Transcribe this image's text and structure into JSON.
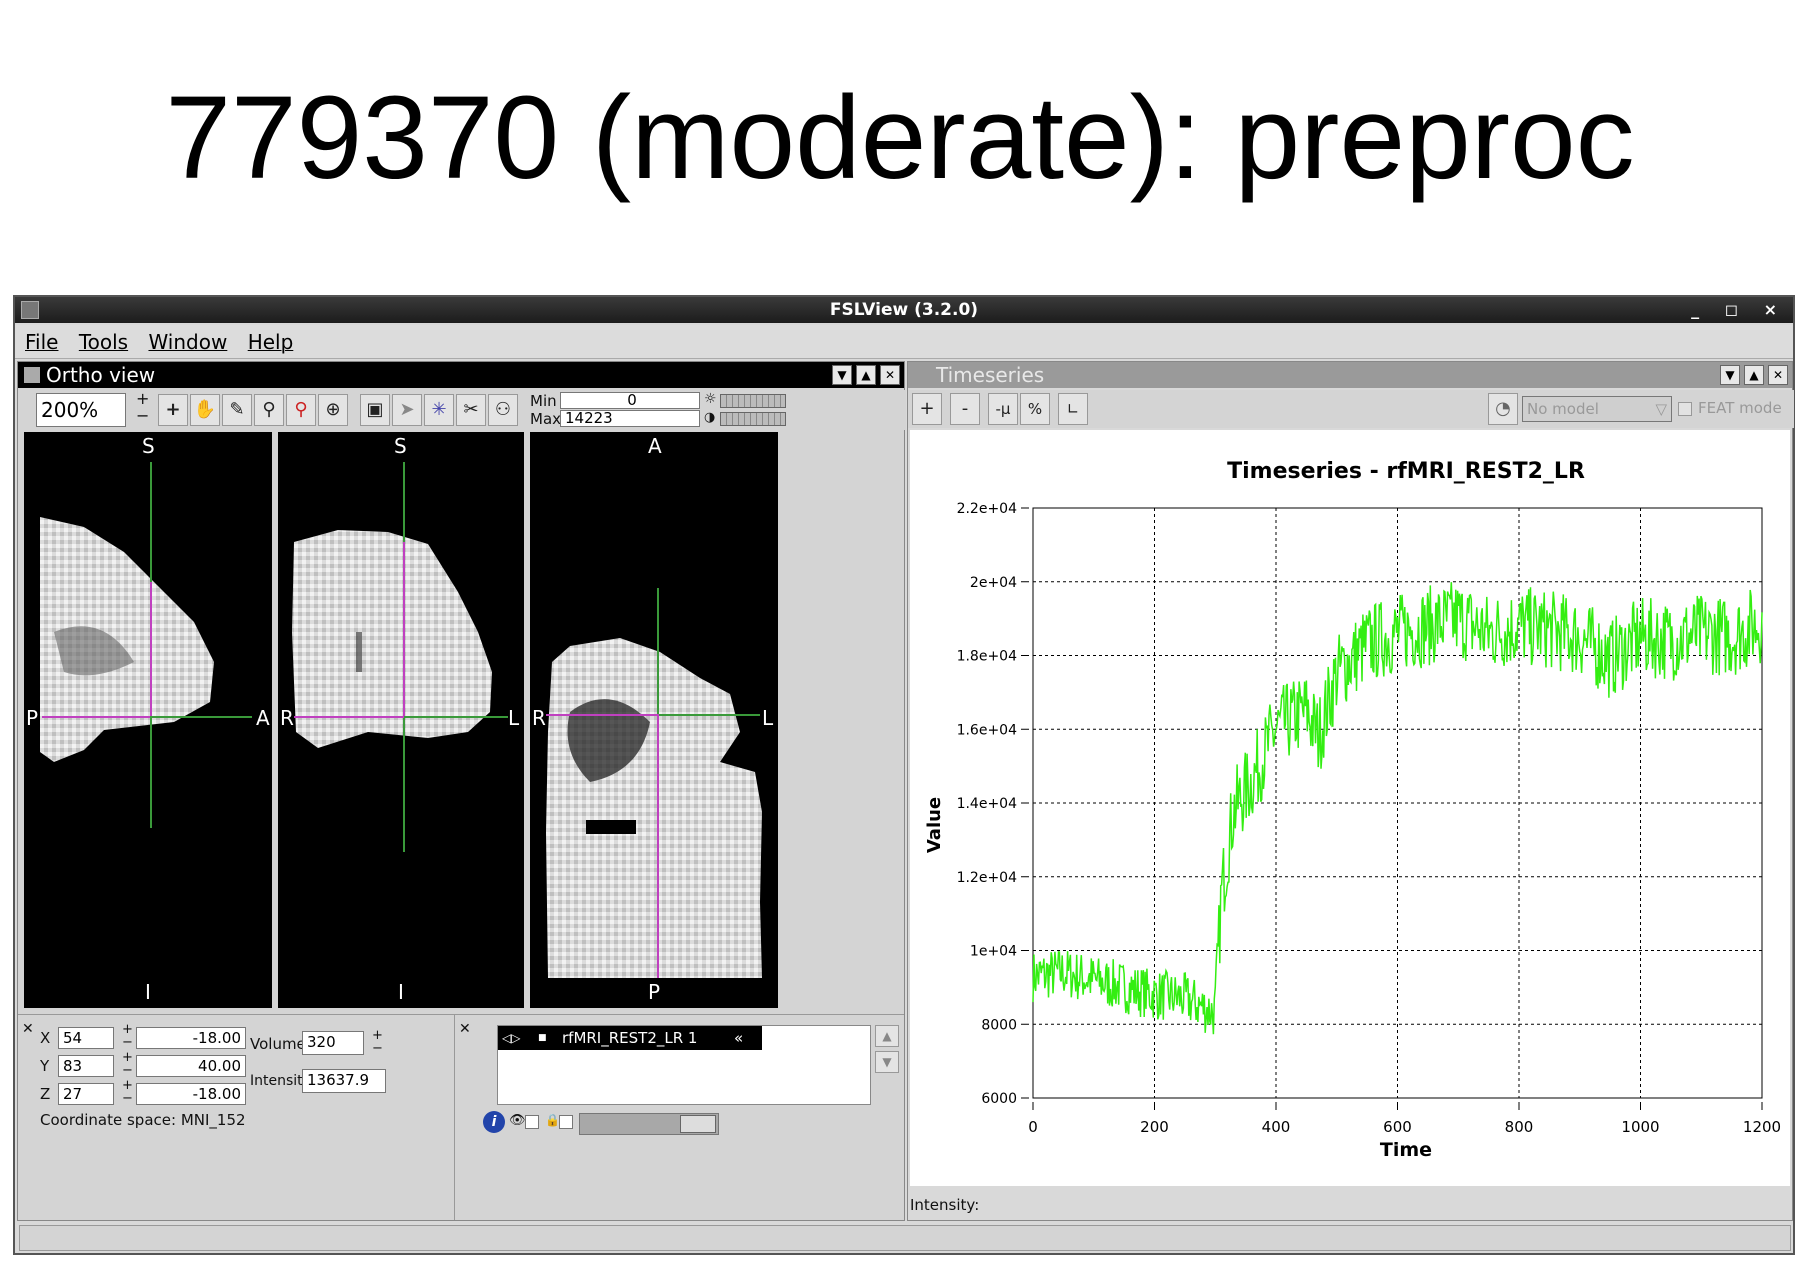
{
  "slide": {
    "title": "779370 (moderate): preproc"
  },
  "window": {
    "title": "FSLView (3.2.0)",
    "controls": "_ ◻ ×"
  },
  "menu": [
    "File",
    "Tools",
    "Window",
    "Help"
  ],
  "ortho": {
    "title": "Ortho view",
    "zoom": "200%",
    "min_label": "Min",
    "min_value": "0",
    "max_label": "Max",
    "max_value": "14223",
    "views": [
      {
        "top": "S",
        "bottom": "I",
        "left": "P",
        "right": "A"
      },
      {
        "top": "S",
        "bottom": "I",
        "left": "R",
        "right": "L"
      },
      {
        "top": "A",
        "bottom": "P",
        "left": "R",
        "right": "L"
      }
    ]
  },
  "coords": {
    "x_label": "X",
    "x_vox": "54",
    "x_mm": "-18.00",
    "y_label": "Y",
    "y_vox": "83",
    "y_mm": "40.00",
    "z_label": "Z",
    "z_vox": "27",
    "z_mm": "-18.00",
    "volume_label": "Volume",
    "volume_value": "320",
    "intensity_label": "Intensity",
    "intensity_value": "13637.9",
    "coord_space": "Coordinate space: MNI_152"
  },
  "layers": {
    "items": [
      "rfMRI_REST2_LR 1"
    ]
  },
  "timeseries": {
    "title": "Timeseries",
    "buttons": [
      "+",
      "-",
      "-μ",
      "%"
    ],
    "model_placeholder": "No model",
    "feat_mode": "FEAT mode",
    "intensity_status": "Intensity:"
  },
  "colors": {
    "signal": "#33ee11",
    "crosshair_green": "#3a9a3a",
    "crosshair_magenta": "#c040c0"
  },
  "chart_data": {
    "type": "line",
    "title": "Timeseries - rfMRI_REST2_LR",
    "xlabel": "Time",
    "ylabel": "Value",
    "xlim": [
      0,
      1200
    ],
    "ylim": [
      6000,
      22000
    ],
    "xticks": [
      "0",
      "200",
      "400",
      "600",
      "800",
      "1000",
      "1200"
    ],
    "yticks": [
      "6000",
      "8000",
      "1e+04",
      "1.2e+04",
      "1.4e+04",
      "1.6e+04",
      "1.8e+04",
      "2e+04",
      "2.2e+04"
    ],
    "grid": true,
    "series": [
      {
        "x": [
          0,
          50,
          100,
          150,
          200,
          250,
          300,
          310,
          330,
          360,
          400,
          450,
          470,
          500,
          550,
          600,
          650,
          700,
          750,
          800,
          850,
          900,
          950,
          1000,
          1050,
          1100,
          1150,
          1200
        ],
        "y": [
          9300,
          9400,
          9200,
          9000,
          8800,
          8700,
          8300,
          11500,
          13800,
          14600,
          16000,
          16500,
          15800,
          17500,
          18300,
          18600,
          18800,
          19000,
          18600,
          18800,
          18700,
          18500,
          17900,
          18500,
          18400,
          18600,
          18500,
          18900
        ]
      }
    ]
  }
}
